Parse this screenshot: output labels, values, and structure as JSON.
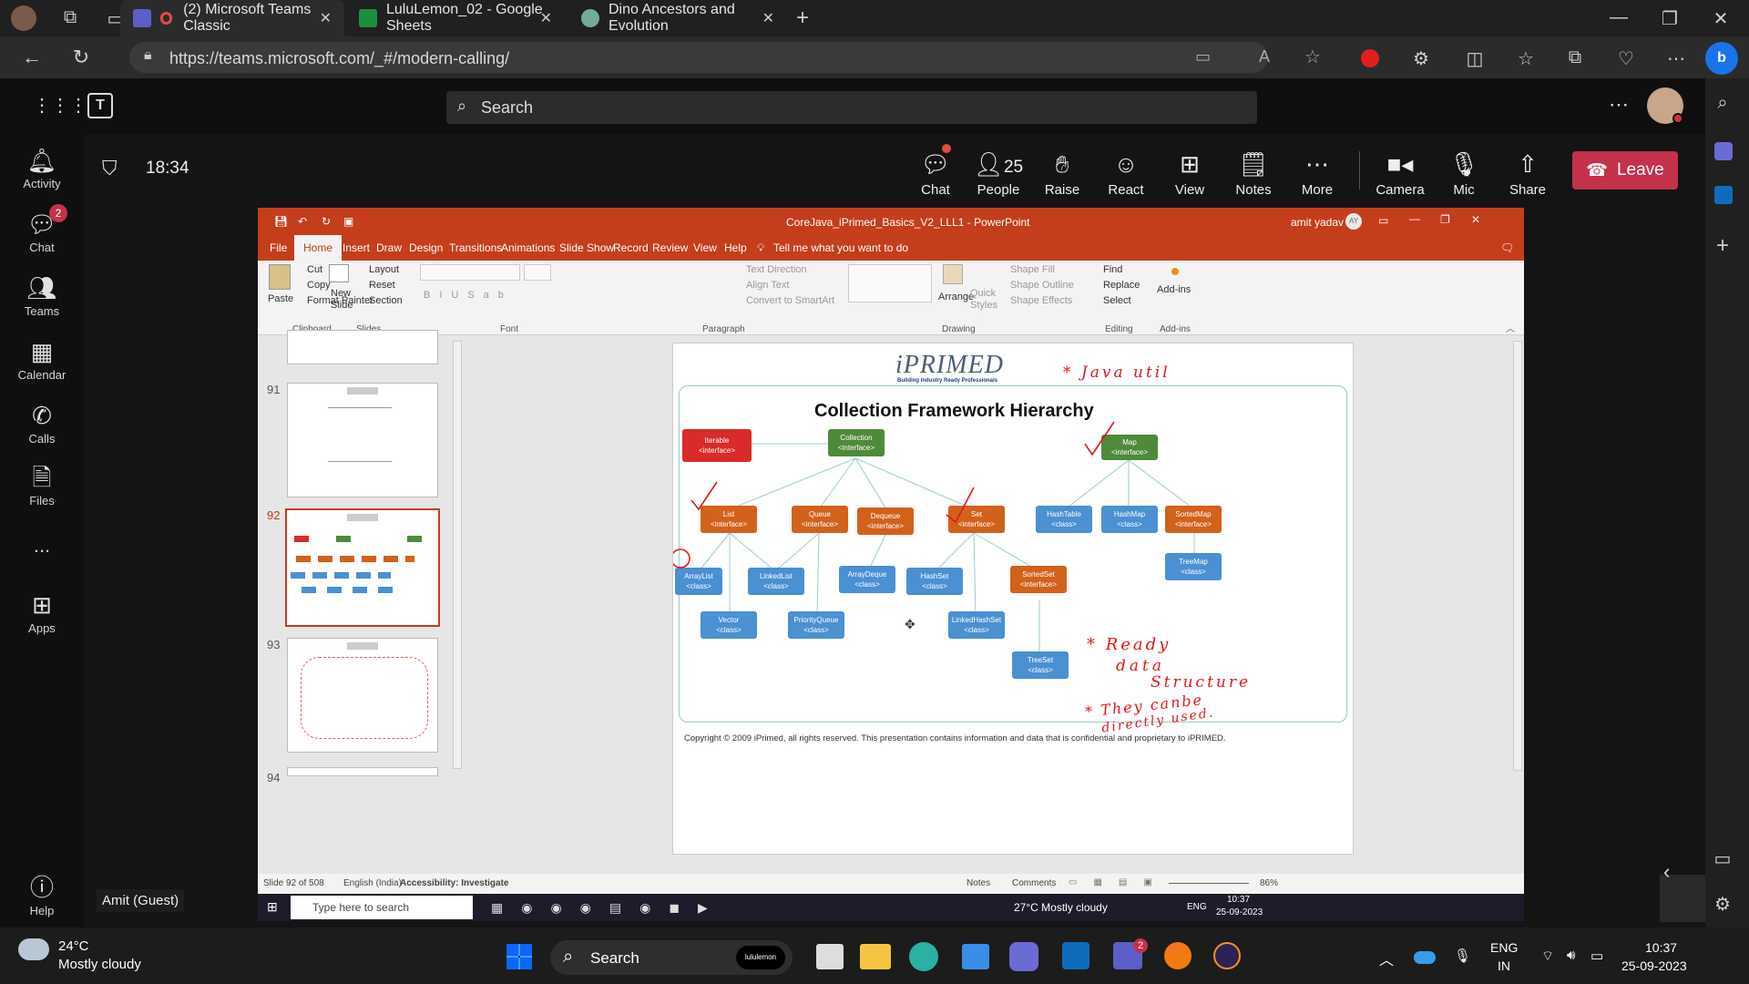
{
  "browser": {
    "tabs": [
      {
        "label": "(2) Microsoft Teams Classic",
        "active": true
      },
      {
        "label": "LuluLemon_02 - Google Sheets",
        "active": false
      },
      {
        "label": "Dino Ancestors and Evolution",
        "active": false
      }
    ],
    "url": "https://teams.microsoft.com/_#/modern-calling/"
  },
  "teams": {
    "search_placeholder": "Search",
    "rail": [
      {
        "label": "Activity",
        "icon": "bell-icon"
      },
      {
        "label": "Chat",
        "icon": "chat-icon",
        "badge": "2"
      },
      {
        "label": "Teams",
        "icon": "teams-icon"
      },
      {
        "label": "Calendar",
        "icon": "calendar-icon"
      },
      {
        "label": "Calls",
        "icon": "phone-icon"
      },
      {
        "label": "Files",
        "icon": "file-icon"
      },
      {
        "label": "Apps",
        "icon": "apps-icon"
      },
      {
        "label": "Help",
        "icon": "help-icon"
      }
    ],
    "more_dots": "...",
    "timer": "18:34",
    "controls": [
      {
        "label": "Chat"
      },
      {
        "label": "People",
        "count": "25"
      },
      {
        "label": "Raise"
      },
      {
        "label": "React"
      },
      {
        "label": "View"
      },
      {
        "label": "Notes"
      },
      {
        "label": "More"
      },
      {
        "label": "Camera"
      },
      {
        "label": "Mic"
      },
      {
        "label": "Share"
      }
    ],
    "leave": "Leave",
    "participant": "Amit (Guest)"
  },
  "ppt": {
    "title": "CoreJava_iPrimed_Basics_V2_LLL1  -  PowerPoint",
    "user": "amit yadav",
    "user_initials": "AY",
    "menus": [
      "File",
      "Home",
      "Insert",
      "Draw",
      "Design",
      "Transitions",
      "Animations",
      "Slide Show",
      "Record",
      "Review",
      "View",
      "Help"
    ],
    "tell_me": "Tell me what you want to do",
    "ribbon": {
      "paste": "Paste",
      "cut": "Cut",
      "copy": "Copy",
      "format_painter": "Format Painter",
      "new_slide": "New Slide",
      "layout": "Layout",
      "reset": "Reset",
      "section": "Section",
      "text_direction": "Text Direction",
      "align_text": "Align Text",
      "convert_smartart": "Convert to SmartArt",
      "arrange": "Arrange",
      "quick_styles": "Quick Styles",
      "shape_fill": "Shape Fill",
      "shape_outline": "Shape Outline",
      "shape_effects": "Shape Effects",
      "find": "Find",
      "replace": "Replace",
      "select": "Select",
      "addins": "Add-ins",
      "groups": [
        "Clipboard",
        "Slides",
        "Font",
        "Paragraph",
        "Drawing",
        "Editing",
        "Add-ins"
      ]
    },
    "thumb_numbers": [
      "91",
      "92",
      "93",
      "94"
    ],
    "slide": {
      "logo": "iPRIMED",
      "tagline": "Building Industry Ready Professionals",
      "title": "Collection Framework Hierarchy",
      "copyright": "Copyright © 2009 iPrimed, all rights reserved. This presentation contains information  and data  that is confidential and proprietary to iPRIMED.",
      "nodes": [
        {
          "name": "Iterable",
          "type": "<interface>",
          "color": "red"
        },
        {
          "name": "Collection",
          "type": "<interface>",
          "color": "green"
        },
        {
          "name": "Map",
          "type": "<interface>",
          "color": "green"
        },
        {
          "name": "List",
          "type": "<interface>",
          "color": "orange"
        },
        {
          "name": "Queue",
          "type": "<interface>",
          "color": "orange"
        },
        {
          "name": "Dequeue",
          "type": "<interface>",
          "color": "orange"
        },
        {
          "name": "Set",
          "type": "<interface>",
          "color": "orange"
        },
        {
          "name": "HashTable",
          "type": "<class>",
          "color": "blue"
        },
        {
          "name": "HashMap",
          "type": "<class>",
          "color": "blue"
        },
        {
          "name": "SortedMap",
          "type": "<interface>",
          "color": "orange"
        },
        {
          "name": "ArrayList",
          "type": "<class>",
          "color": "blue"
        },
        {
          "name": "LinkedList",
          "type": "<class>",
          "color": "blue"
        },
        {
          "name": "ArrayDeque",
          "type": "<class>",
          "color": "blue"
        },
        {
          "name": "HashSet",
          "type": "<class>",
          "color": "blue"
        },
        {
          "name": "SortedSet",
          "type": "<interface>",
          "color": "orange"
        },
        {
          "name": "TreeMap",
          "type": "<class>",
          "color": "blue"
        },
        {
          "name": "Vector",
          "type": "<class>",
          "color": "blue"
        },
        {
          "name": "PriorityQueue",
          "type": "<class>",
          "color": "blue"
        },
        {
          "name": "LinkedHashSet",
          "type": "<class>",
          "color": "blue"
        },
        {
          "name": "TreeSet",
          "type": "<class>",
          "color": "blue"
        }
      ],
      "ink": {
        "java_util": "* Java util",
        "ready": "* Ready",
        "data": "data",
        "structure": "Structure",
        "they": "* They canbe",
        "directly": "directly used."
      }
    },
    "status": {
      "slide": "Slide 92 of 508",
      "language": "English (India)",
      "accessibility": "Accessibility: Investigate",
      "notes": "Notes",
      "comments": "Comments",
      "zoom": "86%"
    },
    "inner_taskbar": {
      "search": "Type here to search",
      "weather": "27°C  Mostly cloudy",
      "lang": "ENG",
      "time": "10:37",
      "date": "25-09-2023"
    }
  },
  "os": {
    "weather_temp": "24°C",
    "weather_desc": "Mostly cloudy",
    "search": "Search",
    "lululemon": "lululemon",
    "lang1": "ENG",
    "lang2": "IN",
    "time": "10:37",
    "date": "25-09-2023",
    "teams_badge": "2"
  },
  "colors": {
    "leave": "#c4314b",
    "ppt_accent": "#c43e1c",
    "teams_badge": "#c4314b"
  }
}
